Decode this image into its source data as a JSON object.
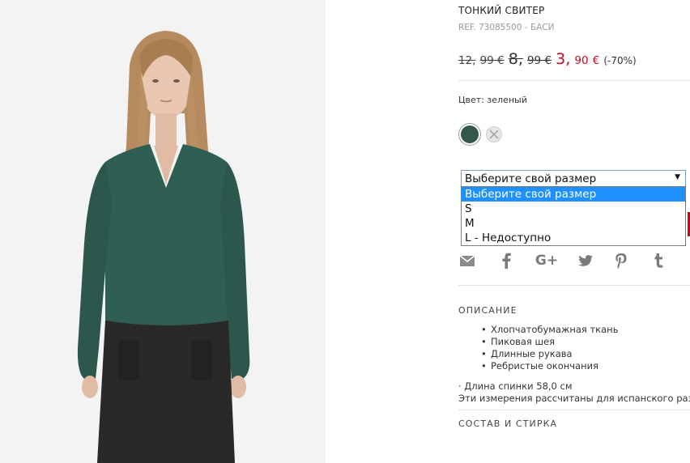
{
  "product": {
    "title": "ТОНКИЙ СВИТЕР",
    "ref": "REF. 73085500 - БАСИ"
  },
  "price": {
    "original_int": "12,",
    "original_dec": "99 €",
    "previous_int": "8,",
    "previous_dec": "99 €",
    "current_int": "3,",
    "current_dec": "90",
    "current_currency": "€",
    "discount": "(-70%)"
  },
  "colors": {
    "label": "Цвет: зеленый",
    "swatches": [
      {
        "name": "green",
        "hex": "#335849"
      },
      {
        "name": "unavailable",
        "hex": "#e6e6e6"
      }
    ]
  },
  "size_select": {
    "value": "Выберите свой размер",
    "options": [
      "Выберите свой размер",
      "S",
      "M",
      "L - Недоступно"
    ],
    "selected_index": 0
  },
  "share": {
    "icons": [
      "mail-icon",
      "facebook-icon",
      "google-plus-icon",
      "twitter-icon",
      "pinterest-icon",
      "tumblr-icon"
    ],
    "google_plus": "G+"
  },
  "description": {
    "title": "ОПИСАНИЕ",
    "bullets": [
      "Хлопчатобумажная ткань",
      "Пиковая шея",
      "Длинные рукава",
      "Ребристые окончания"
    ],
    "length": "· Длина спинки 58,0 см",
    "sizes_note": "Эти измерения рассчитаны для испанского размера"
  },
  "composition": {
    "title": "СОСТАВ И СТИРКА"
  },
  "theme": {
    "sale_color": "#c4091c",
    "sweater_color": "#2f5e53",
    "selected_option_bg": "#1e90ff"
  }
}
